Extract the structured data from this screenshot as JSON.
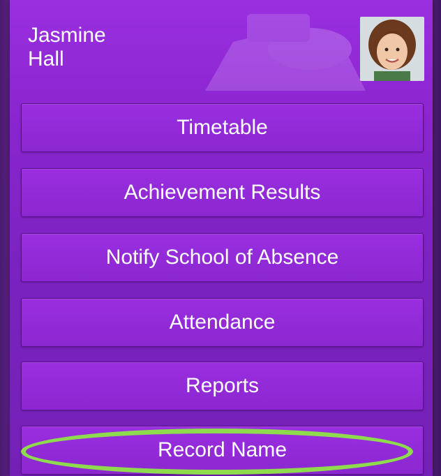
{
  "student": {
    "name": "Jasmine\nHall"
  },
  "menu": {
    "items": [
      {
        "label": "Timetable"
      },
      {
        "label": "Achievement Results"
      },
      {
        "label": "Notify School of Absence"
      },
      {
        "label": "Attendance"
      },
      {
        "label": "Reports"
      },
      {
        "label": "Record Name"
      }
    ]
  },
  "colors": {
    "panel": "#8a25cf",
    "button_border": "#5a1389",
    "highlight": "#8edc4e"
  }
}
